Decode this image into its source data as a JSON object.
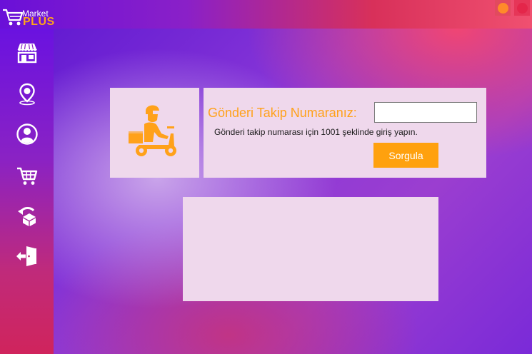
{
  "app": {
    "logo_market": "Market",
    "logo_plus": "PLUS"
  },
  "colors": {
    "accent": "#ffa11a",
    "panel": "#efd8ec",
    "minimize": "#ff8a2a",
    "close": "#e4264a"
  },
  "window_controls": {
    "minimize_icon": "circle-orange",
    "close_icon": "circle-red"
  },
  "sidebar": {
    "items": [
      {
        "icon": "store-icon"
      },
      {
        "icon": "location-pin-icon"
      },
      {
        "icon": "user-icon"
      },
      {
        "icon": "cart-icon"
      },
      {
        "icon": "return-box-icon"
      },
      {
        "icon": "logout-door-icon"
      }
    ]
  },
  "tracking": {
    "icon": "delivery-scooter-icon",
    "label": "Gönderi Takip Numaranız:",
    "input_value": "",
    "hint": "Gönderi takip numarası için 1001 şeklinde giriş yapın.",
    "button_label": "Sorgula"
  }
}
